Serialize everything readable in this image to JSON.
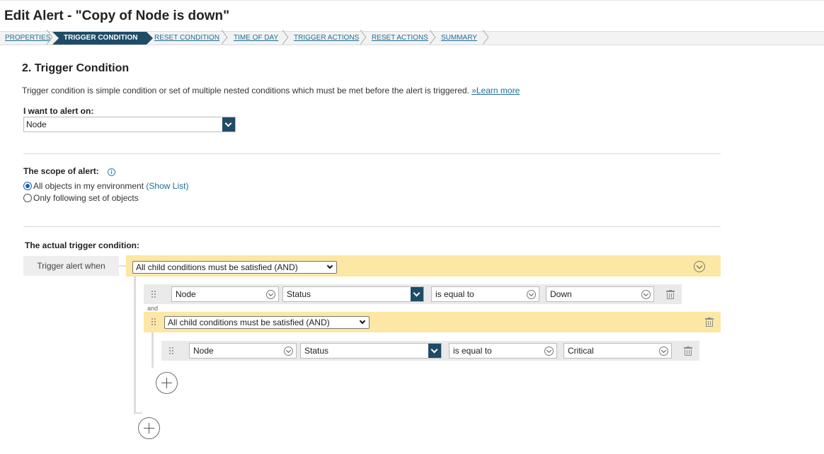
{
  "page": {
    "title": "Edit Alert - \"Copy of Node is down\""
  },
  "steps": [
    {
      "label": "PROPERTIES",
      "active": false
    },
    {
      "label": "TRIGGER CONDITION",
      "active": true
    },
    {
      "label": "RESET CONDITION",
      "active": false
    },
    {
      "label": "TIME OF DAY",
      "active": false
    },
    {
      "label": "TRIGGER ACTIONS",
      "active": false
    },
    {
      "label": "RESET ACTIONS",
      "active": false
    },
    {
      "label": "SUMMARY",
      "active": false
    }
  ],
  "section": {
    "title": "2. Trigger Condition",
    "description": "Trigger condition is simple condition or set of multiple nested conditions which must be met before the alert is triggered. ",
    "learn_more": "»Learn more"
  },
  "alert_on": {
    "label": "I want to alert on:",
    "value": "Node"
  },
  "scope": {
    "label": "The scope of alert:",
    "options": [
      {
        "label": "All objects in my environment",
        "link": "(Show List)",
        "selected": true
      },
      {
        "label": "Only following set of objects",
        "link": "",
        "selected": false
      }
    ]
  },
  "trigger": {
    "label": "The actual trigger condition:",
    "when_label": "Trigger alert when",
    "root_operator": "All child conditions must be satisfied (AND)",
    "conditions": [
      {
        "object": "Node",
        "field": "Status",
        "operator": "is equal to",
        "value": "Down"
      }
    ],
    "joiner": "and",
    "nested_group": {
      "operator": "All child conditions must be satisfied (AND)",
      "conditions": [
        {
          "object": "Node",
          "field": "Status",
          "operator": "is equal to",
          "value": "Critical"
        }
      ]
    }
  },
  "colors": {
    "accent": "#1e4c67",
    "link": "#1f6f97",
    "group_band": "#fce8a4",
    "condition_row": "#eaeaea"
  }
}
